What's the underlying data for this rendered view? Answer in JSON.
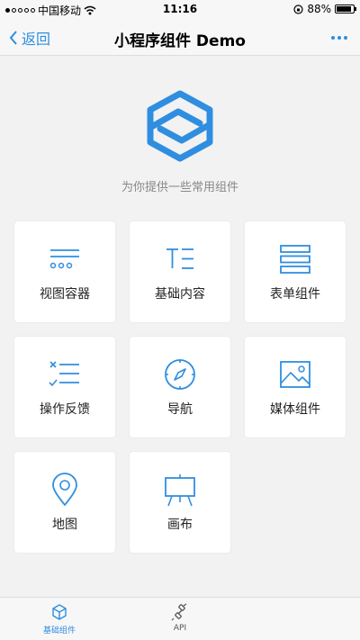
{
  "status_bar": {
    "carrier": "中国移动",
    "time": "11:16",
    "battery": "88%",
    "battery_level": 0.88
  },
  "nav": {
    "back_label": "返回",
    "title": "小程序组件 Demo"
  },
  "header": {
    "subtitle": "为你提供一些常用组件"
  },
  "components": [
    {
      "label": "视图容器",
      "icon": "view-container-icon"
    },
    {
      "label": "基础内容",
      "icon": "basic-content-icon"
    },
    {
      "label": "表单组件",
      "icon": "form-icon"
    },
    {
      "label": "操作反馈",
      "icon": "feedback-icon"
    },
    {
      "label": "导航",
      "icon": "compass-icon"
    },
    {
      "label": "媒体组件",
      "icon": "image-icon"
    },
    {
      "label": "地图",
      "icon": "map-pin-icon"
    },
    {
      "label": "画布",
      "icon": "easel-icon"
    }
  ],
  "tabbar": {
    "tabs": [
      {
        "label": "基础组件",
        "icon": "cube-icon",
        "active": true
      },
      {
        "label": "API",
        "icon": "api-icon",
        "active": false
      }
    ]
  },
  "colors": {
    "accent": "#2f8ee0",
    "background": "#f2f2f2",
    "card": "#ffffff"
  }
}
